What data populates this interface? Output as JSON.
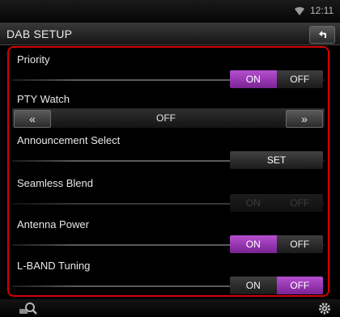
{
  "status": {
    "time": "12:11",
    "wifi_icon": "wifi-icon"
  },
  "header": {
    "title": "DAB SETUP",
    "back_icon": "back-arrow-icon"
  },
  "accent_color": "#9a3ab3",
  "frame_color": "#d40000",
  "settings": {
    "priority": {
      "label": "Priority",
      "on": "ON",
      "off": "OFF",
      "selected": "ON"
    },
    "pty_watch": {
      "label": "PTY Watch",
      "prev": "«",
      "value": "OFF",
      "next": "»"
    },
    "announcement": {
      "label": "Announcement Select",
      "button": "SET"
    },
    "seamless_blend": {
      "label": "Seamless Blend",
      "on": "ON",
      "off": "OFF",
      "enabled": false
    },
    "antenna_power": {
      "label": "Antenna Power",
      "on": "ON",
      "off": "OFF",
      "selected": "ON"
    },
    "lband_tuning": {
      "label": "L-BAND Tuning",
      "on": "ON",
      "off": "OFF",
      "selected": "OFF"
    }
  },
  "footer": {
    "left_icon": "search-icon",
    "right_icon": "gear-icon"
  }
}
